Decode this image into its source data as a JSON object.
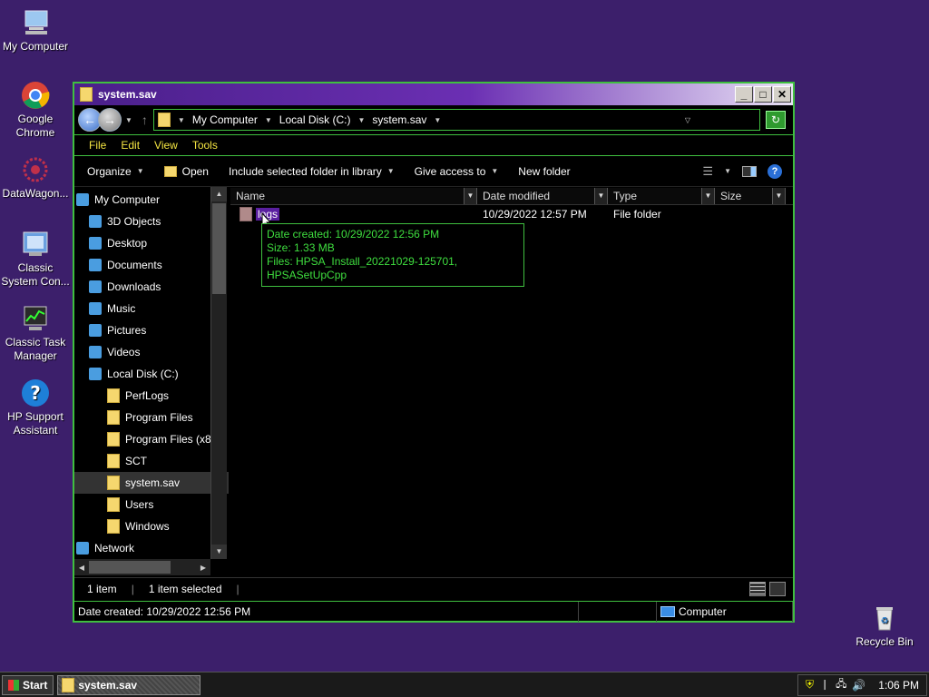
{
  "desktop": {
    "icons": [
      {
        "label": "My Computer"
      },
      {
        "label": "Google Chrome"
      },
      {
        "label": "DataWagon..."
      },
      {
        "label": "Classic System Con..."
      },
      {
        "label": "Classic Task Manager"
      },
      {
        "label": "HP Support Assistant"
      },
      {
        "label": "Recycle Bin"
      }
    ]
  },
  "window": {
    "title": "system.sav",
    "controls": {
      "minimize": "_",
      "maximize": "□",
      "close": "✕"
    },
    "address": {
      "crumbs": [
        "My Computer",
        "Local Disk (C:)",
        "system.sav"
      ]
    },
    "menu": [
      "File",
      "Edit",
      "View",
      "Tools"
    ],
    "toolbar": {
      "organize": "Organize",
      "open": "Open",
      "include": "Include selected folder in library",
      "give_access": "Give access to",
      "new_folder": "New folder"
    },
    "nav": {
      "items": [
        {
          "label": "My Computer",
          "indent": 0
        },
        {
          "label": "3D Objects",
          "indent": 1
        },
        {
          "label": "Desktop",
          "indent": 1
        },
        {
          "label": "Documents",
          "indent": 1
        },
        {
          "label": "Downloads",
          "indent": 1
        },
        {
          "label": "Music",
          "indent": 1
        },
        {
          "label": "Pictures",
          "indent": 1
        },
        {
          "label": "Videos",
          "indent": 1
        },
        {
          "label": "Local Disk (C:)",
          "indent": 1
        },
        {
          "label": "PerfLogs",
          "indent": 2
        },
        {
          "label": "Program Files",
          "indent": 2
        },
        {
          "label": "Program Files (x86)",
          "indent": 2
        },
        {
          "label": "SCT",
          "indent": 2
        },
        {
          "label": "system.sav",
          "indent": 2,
          "selected": true
        },
        {
          "label": "Users",
          "indent": 2
        },
        {
          "label": "Windows",
          "indent": 2
        },
        {
          "label": "Network",
          "indent": 0
        }
      ]
    },
    "columns": [
      "Name",
      "Date modified",
      "Type",
      "Size"
    ],
    "files": [
      {
        "name": "logs",
        "date": "10/29/2022 12:57 PM",
        "type": "File folder",
        "size": ""
      }
    ],
    "tooltip": {
      "line1": "Date created: 10/29/2022 12:56 PM",
      "line2": "Size: 1.33 MB",
      "line3": "Files: HPSA_Install_20221029-125701, HPSASetUpCpp"
    },
    "status": {
      "count": "1 item",
      "selected": "1 item selected",
      "details": "Date created: 10/29/2022 12:56 PM",
      "zone": "Computer"
    }
  },
  "taskbar": {
    "start": "Start",
    "task": "system.sav",
    "clock": "1:06 PM"
  }
}
